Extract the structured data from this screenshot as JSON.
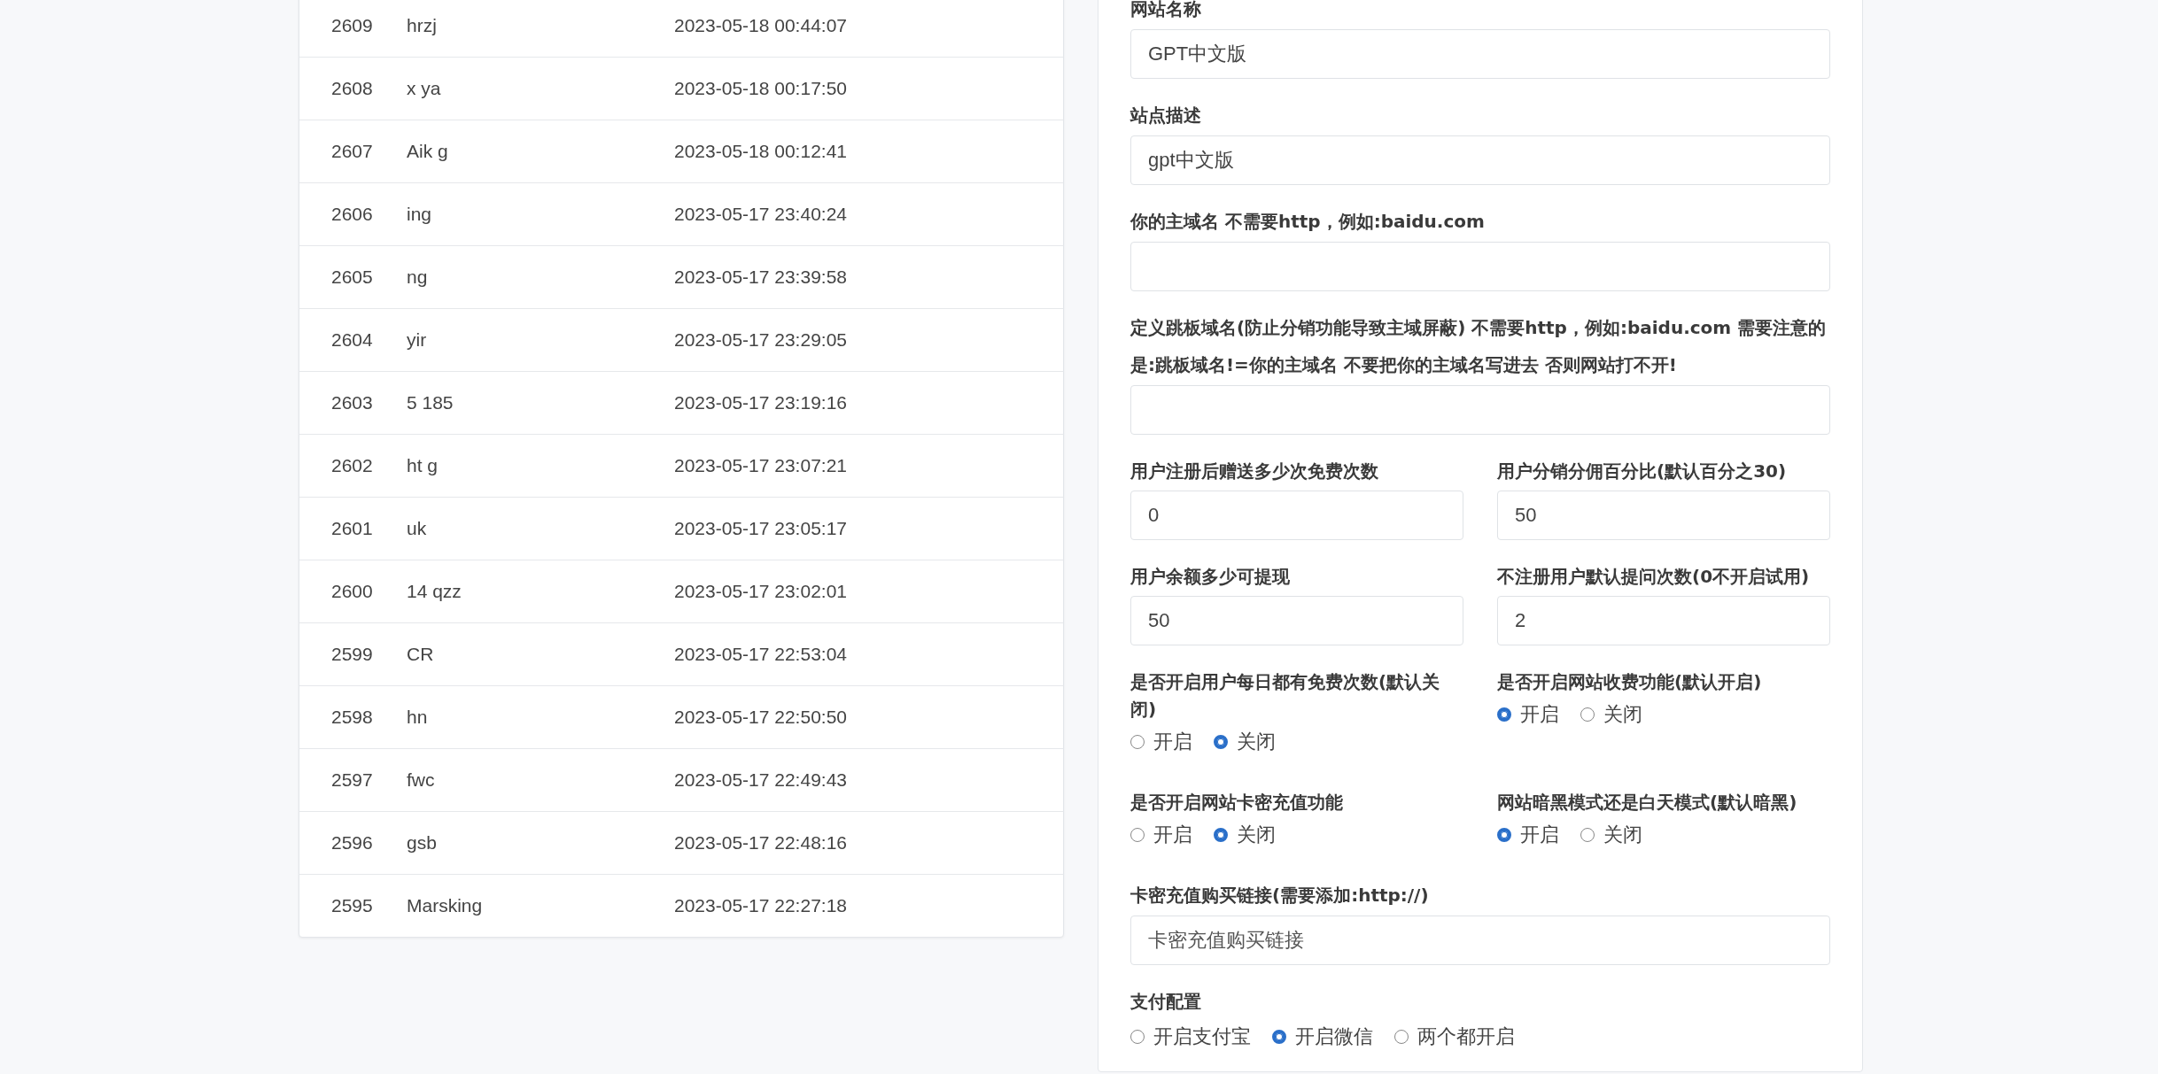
{
  "users": [
    {
      "id": "2609",
      "name": "hrzj",
      "time": "2023-05-18 00:44:07"
    },
    {
      "id": "2608",
      "name": "x ya",
      "time": "2023-05-18 00:17:50"
    },
    {
      "id": "2607",
      "name": "Aik g",
      "time": "2023-05-18 00:12:41"
    },
    {
      "id": "2606",
      "name": "ing",
      "time": "2023-05-17 23:40:24"
    },
    {
      "id": "2605",
      "name": "ng",
      "time": "2023-05-17 23:39:58"
    },
    {
      "id": "2604",
      "name": "yir",
      "time": "2023-05-17 23:29:05"
    },
    {
      "id": "2603",
      "name": "5 185",
      "time": "2023-05-17 23:19:16"
    },
    {
      "id": "2602",
      "name": "ht g",
      "time": "2023-05-17 23:07:21"
    },
    {
      "id": "2601",
      "name": "uk",
      "time": "2023-05-17 23:05:17"
    },
    {
      "id": "2600",
      "name": "14 qzz",
      "time": "2023-05-17 23:02:01"
    },
    {
      "id": "2599",
      "name": "CR",
      "time": "2023-05-17 22:53:04"
    },
    {
      "id": "2598",
      "name": "hn",
      "time": "2023-05-17 22:50:50"
    },
    {
      "id": "2597",
      "name": "fwc",
      "time": "2023-05-17 22:49:43"
    },
    {
      "id": "2596",
      "name": "gsb",
      "time": "2023-05-17 22:48:16"
    },
    {
      "id": "2595",
      "name": "Marsking",
      "time": "2023-05-17 22:27:18"
    }
  ],
  "settings": [
    {
      "items": [
        {
          "kind": "input",
          "label": "网站名称",
          "value": "GPT中文版"
        }
      ]
    },
    {
      "items": [
        {
          "kind": "input",
          "label": "站点描述",
          "value": "gpt中文版"
        }
      ]
    },
    {
      "items": [
        {
          "kind": "input",
          "label": "你的主域名 不需要http，例如:baidu.com"
        }
      ]
    },
    {
      "items": [
        {
          "kind": "input",
          "label": "定义跳板域名(防止分销功能导致主域屏蔽) 不需要http，例如:baidu.com 需要注意的是:跳板域名!=你的主域名 不要把你的主域名写进去 否则网站打不开!"
        }
      ]
    },
    {
      "items": [
        {
          "kind": "input",
          "label": "用户注册后赠送多少次免费次数",
          "value": "0"
        },
        {
          "kind": "input",
          "label": "用户分销分佣百分比(默认百分之30)",
          "value": "50"
        }
      ]
    },
    {
      "items": [
        {
          "kind": "input",
          "label": "用户余额多少可提现",
          "value": "50"
        },
        {
          "kind": "input",
          "label": "不注册用户默认提问次数(0不开启试用)",
          "value": "2"
        }
      ]
    },
    {
      "items": [
        {
          "kind": "radio",
          "label": "是否开启用户每日都有免费次数(默认关闭)",
          "options": [
            {
              "label": "开启",
              "selected": false
            },
            {
              "label": "关闭",
              "selected": true
            }
          ]
        },
        {
          "kind": "radio",
          "label": "是否开启网站收费功能(默认开启)",
          "options": [
            {
              "label": "开启",
              "selected": true
            },
            {
              "label": "关闭",
              "selected": false
            }
          ]
        }
      ]
    },
    {
      "items": [
        {
          "kind": "radio",
          "label": "是否开启网站卡密充值功能",
          "options": [
            {
              "label": "开启",
              "selected": false
            },
            {
              "label": "关闭",
              "selected": true
            }
          ]
        },
        {
          "kind": "radio",
          "label": "网站暗黑模式还是白天模式(默认暗黑)",
          "options": [
            {
              "label": "开启",
              "selected": true
            },
            {
              "label": "关闭",
              "selected": false
            }
          ]
        }
      ]
    },
    {
      "items": [
        {
          "kind": "input",
          "label": "卡密充值购买链接(需要添加:http://)",
          "placeholder": "卡密充值购买链接"
        }
      ]
    },
    {
      "items": [
        {
          "kind": "radio",
          "label": "支付配置",
          "options": [
            {
              "label": "开启支付宝",
              "selected": false
            },
            {
              "label": "开启微信",
              "selected": true
            },
            {
              "label": "两个都开启",
              "selected": false
            }
          ]
        }
      ]
    }
  ]
}
